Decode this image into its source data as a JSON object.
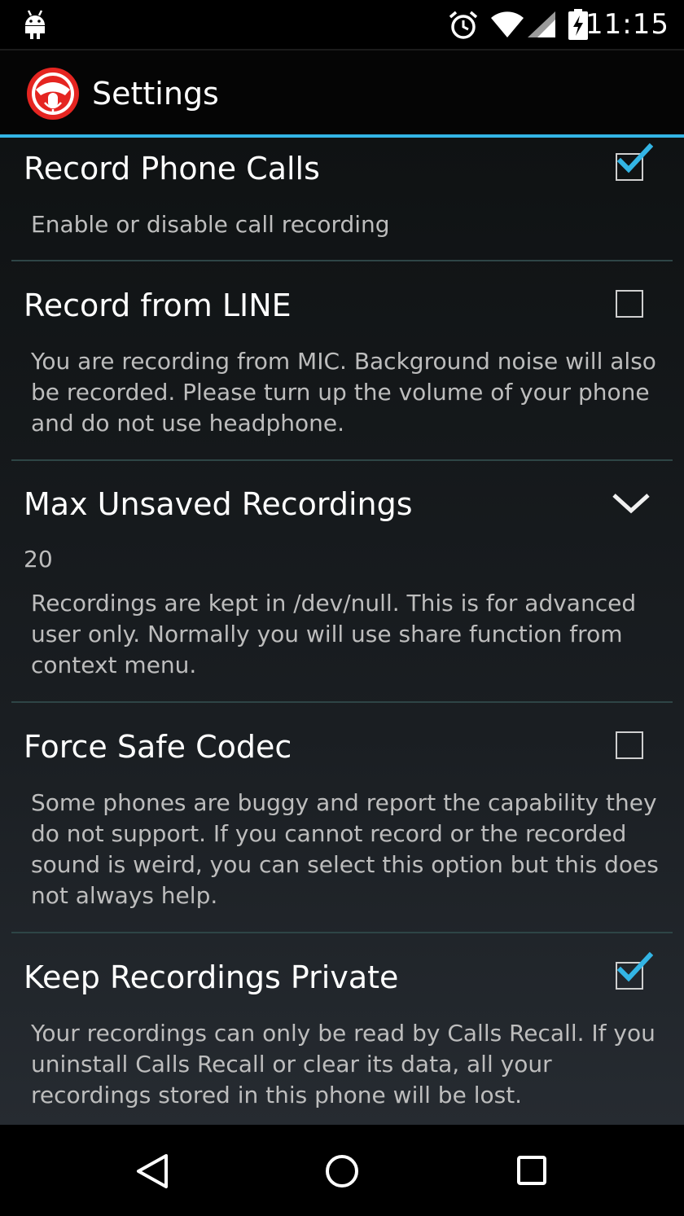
{
  "status_bar": {
    "time": "11:15",
    "icons": [
      "android-icon",
      "alarm-icon",
      "wifi-icon",
      "signal-icon",
      "battery-charging-icon"
    ]
  },
  "action_bar": {
    "title": "Settings",
    "app_icon": "calls-recall-logo-icon"
  },
  "colors": {
    "accent": "#33b5e5",
    "checkbox_check": "#33b5e5",
    "app_icon_red": "#e52521"
  },
  "preferences": [
    {
      "title": "Record Phone Calls",
      "summary": "Enable or disable call recording",
      "control": "checkbox",
      "checked": true
    },
    {
      "title": "Record from LINE",
      "summary": "You are recording from MIC. Background noise will also be recorded. Please turn up the volume of your phone and do not use headphone.",
      "control": "checkbox",
      "checked": false
    },
    {
      "title": "Max Unsaved Recordings",
      "value": "20",
      "summary": "Recordings are kept in /dev/null. This is for advanced user only. Normally you will use share function from context menu.",
      "control": "dropdown",
      "icon": "chevron-down-icon"
    },
    {
      "title": "Force Safe Codec",
      "summary": "Some phones are buggy and report the capability they do not support. If you cannot record or the recorded sound is weird, you can select this option but this does not always help.",
      "control": "checkbox",
      "checked": false
    },
    {
      "title": "Keep Recordings Private",
      "summary": "Your recordings can only be read by Calls Recall. If you uninstall Calls Recall or clear its data, all your recordings stored in this phone will be lost.",
      "control": "checkbox",
      "checked": true
    }
  ],
  "nav_bar": {
    "icons": [
      "back-icon",
      "home-icon",
      "recents-icon"
    ]
  }
}
